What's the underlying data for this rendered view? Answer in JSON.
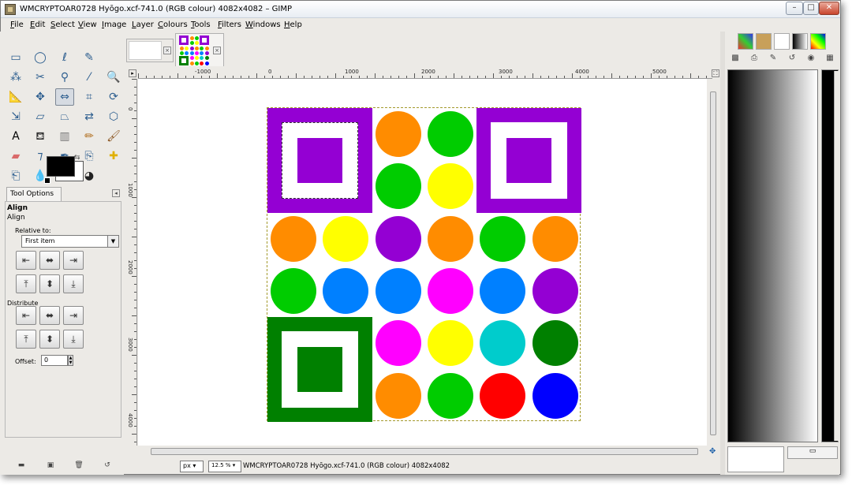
{
  "window": {
    "title": "WMCRYPTOAR0728 Hyōgo.xcf-741.0 (RGB colour) 4082x4082 – GIMP",
    "controls": {
      "minimize": "–",
      "maximize": "□",
      "close": "✕"
    }
  },
  "menubar": [
    "File",
    "Edit",
    "Select",
    "View",
    "Image",
    "Layer",
    "Colours",
    "Tools",
    "Filters",
    "Windows",
    "Help"
  ],
  "toolbox": {
    "tools": [
      "rect-select",
      "ellipse-select",
      "free-select",
      "fuzzy-select",
      "select-by-color",
      "scissors-select",
      "foreground-select",
      "color-picker",
      "zoom",
      "measure",
      "move",
      "align",
      "crop",
      "rotate",
      "scale",
      "shear",
      "perspective",
      "flip",
      "cage",
      "text",
      "bucket-fill",
      "blend",
      "pencil",
      "paintbrush",
      "eraser",
      "airbrush",
      "ink",
      "clone",
      "heal",
      "perspective-clone",
      "blur",
      "smudge",
      "dodge-burn"
    ],
    "selected_tool": "align",
    "colors": {
      "foreground": "#000000",
      "background": "#ffffff"
    }
  },
  "tool_options": {
    "tab_label": "Tool Options",
    "header": "Align",
    "subheader": "Align",
    "relative_to_label": "Relative to:",
    "relative_to_value": "First item",
    "align_buttons": [
      "align-left",
      "align-hcenter",
      "align-right",
      "align-top",
      "align-vcenter",
      "align-bottom"
    ],
    "distribute_label": "Distribute",
    "distribute_buttons": [
      "distribute-left",
      "distribute-hcenter",
      "distribute-right",
      "distribute-top",
      "distribute-vcenter",
      "distribute-bottom"
    ],
    "offset_label": "Offset:",
    "offset_value": "0"
  },
  "canvas": {
    "ruler_labels": [
      "-1000",
      "0",
      "1000",
      "2000",
      "3000",
      "4000",
      "5000"
    ],
    "ruler_left_labels": [
      "0",
      "1000",
      "2000",
      "3000",
      "4000"
    ],
    "unit": "px",
    "zoom": "12.5 %",
    "status": "WMCRYPTOAR0728 Hyōgo.xcf-741.0 (RGB colour) 4082x4082",
    "image_size": "4082x4082"
  },
  "qr_image": {
    "finders": [
      {
        "position": "top-left",
        "color": "#9400d3"
      },
      {
        "position": "top-right",
        "color": "#9400d3"
      },
      {
        "position": "bottom-left",
        "color": "#008000"
      }
    ],
    "circles": [
      {
        "row": 0,
        "col": 2,
        "color": "#ff8c00"
      },
      {
        "row": 0,
        "col": 3,
        "color": "#00cc00"
      },
      {
        "row": 1,
        "col": 2,
        "color": "#00cc00"
      },
      {
        "row": 1,
        "col": 3,
        "color": "#ffff00"
      },
      {
        "row": 2,
        "col": 0,
        "color": "#ff8c00"
      },
      {
        "row": 2,
        "col": 1,
        "color": "#ffff00"
      },
      {
        "row": 2,
        "col": 2,
        "color": "#9400d3"
      },
      {
        "row": 2,
        "col": 3,
        "color": "#ff8c00"
      },
      {
        "row": 2,
        "col": 4,
        "color": "#00cc00"
      },
      {
        "row": 2,
        "col": 5,
        "color": "#ff8c00"
      },
      {
        "row": 3,
        "col": 0,
        "color": "#00cc00"
      },
      {
        "row": 3,
        "col": 1,
        "color": "#0080ff"
      },
      {
        "row": 3,
        "col": 2,
        "color": "#0080ff"
      },
      {
        "row": 3,
        "col": 3,
        "color": "#ff00ff"
      },
      {
        "row": 3,
        "col": 4,
        "color": "#0080ff"
      },
      {
        "row": 3,
        "col": 5,
        "color": "#9400d3"
      },
      {
        "row": 4,
        "col": 2,
        "color": "#ff00ff"
      },
      {
        "row": 4,
        "col": 3,
        "color": "#ffff00"
      },
      {
        "row": 4,
        "col": 4,
        "color": "#00cccc"
      },
      {
        "row": 4,
        "col": 5,
        "color": "#008000"
      },
      {
        "row": 5,
        "col": 2,
        "color": "#ff8c00"
      },
      {
        "row": 5,
        "col": 3,
        "color": "#00cc00"
      },
      {
        "row": 5,
        "col": 4,
        "color": "#ff0000"
      },
      {
        "row": 5,
        "col": 5,
        "color": "#0000ff"
      }
    ]
  },
  "dock": {
    "tabs": [
      "brushes",
      "patterns",
      "paths",
      "gradients",
      "palettes"
    ],
    "icons": [
      "layers",
      "channels",
      "paths",
      "undo",
      "colormap",
      "palette-icon"
    ]
  }
}
